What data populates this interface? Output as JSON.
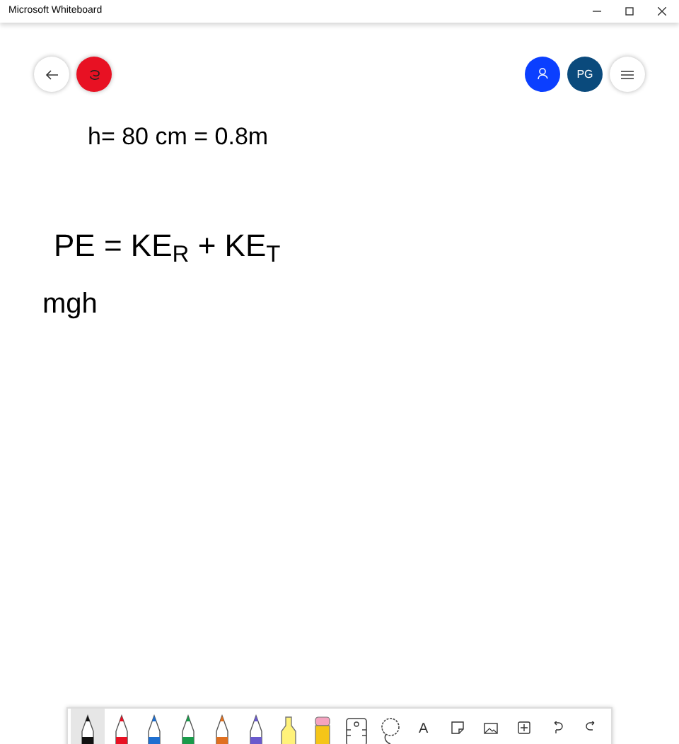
{
  "window": {
    "title": "Microsoft Whiteboard"
  },
  "top_right": {
    "avatar_initials": "PG"
  },
  "ink": [
    {
      "text": "h= 80 cm = 0.8m"
    },
    {
      "text": "PE =  KE$_{R}$ + KE$_{T}$"
    },
    {
      "text": "mgh"
    }
  ],
  "toolbar": [
    {
      "kind": "pen",
      "color": "#111111",
      "selected": true
    },
    {
      "kind": "pen",
      "color": "#e81123",
      "selected": false
    },
    {
      "kind": "pen",
      "color": "#1e6fd0",
      "selected": false
    },
    {
      "kind": "pen",
      "color": "#1a9b4b",
      "selected": false
    },
    {
      "kind": "pen",
      "color": "#e07020",
      "selected": false
    },
    {
      "kind": "pen",
      "color": "#6a5acd",
      "selected": false
    },
    {
      "kind": "highlighter",
      "color": "#fff27a",
      "selected": false
    },
    {
      "kind": "eraser",
      "selected": false
    },
    {
      "kind": "ruler"
    },
    {
      "kind": "lasso"
    },
    {
      "kind": "text",
      "label": "A"
    },
    {
      "kind": "note"
    },
    {
      "kind": "image"
    },
    {
      "kind": "add"
    },
    {
      "kind": "undo"
    },
    {
      "kind": "redo"
    }
  ]
}
